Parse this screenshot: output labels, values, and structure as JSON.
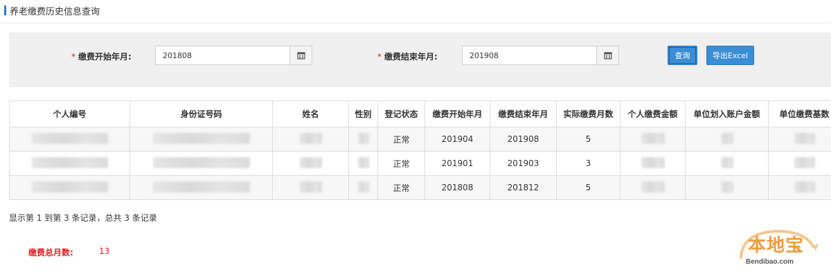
{
  "page": {
    "title": "养老缴费历史信息查询"
  },
  "search": {
    "start": {
      "required_mark": "*",
      "label": "缴费开始年月:",
      "value": "201808"
    },
    "end": {
      "required_mark": "*",
      "label": "缴费结束年月:",
      "value": "201908"
    },
    "query_label": "查询",
    "export_label": "导出Excel"
  },
  "table": {
    "headers": [
      "个人编号",
      "身份证号码",
      "姓名",
      "性别",
      "登记状态",
      "缴费开始年月",
      "缴费结束年月",
      "实际缴费月数",
      "个人缴费金额",
      "单位划入账户金额",
      "单位缴费基数"
    ],
    "rows": [
      {
        "status": "正常",
        "start": "201904",
        "end": "201908",
        "months": "5"
      },
      {
        "status": "正常",
        "start": "201901",
        "end": "201903",
        "months": "3"
      },
      {
        "status": "正常",
        "start": "201808",
        "end": "201812",
        "months": "5"
      }
    ]
  },
  "summary": "显示第 1 到第 3 条记录，总共 3 条记录",
  "total": {
    "label": "缴费总月数:",
    "value": "13"
  },
  "watermark": {
    "text": "本地宝",
    "url": "Bendibao.com"
  },
  "colors": {
    "accent": "#1e7fc1",
    "button": "#3a8ed6",
    "required": "#e02020",
    "watermark": "#f29b3b"
  }
}
